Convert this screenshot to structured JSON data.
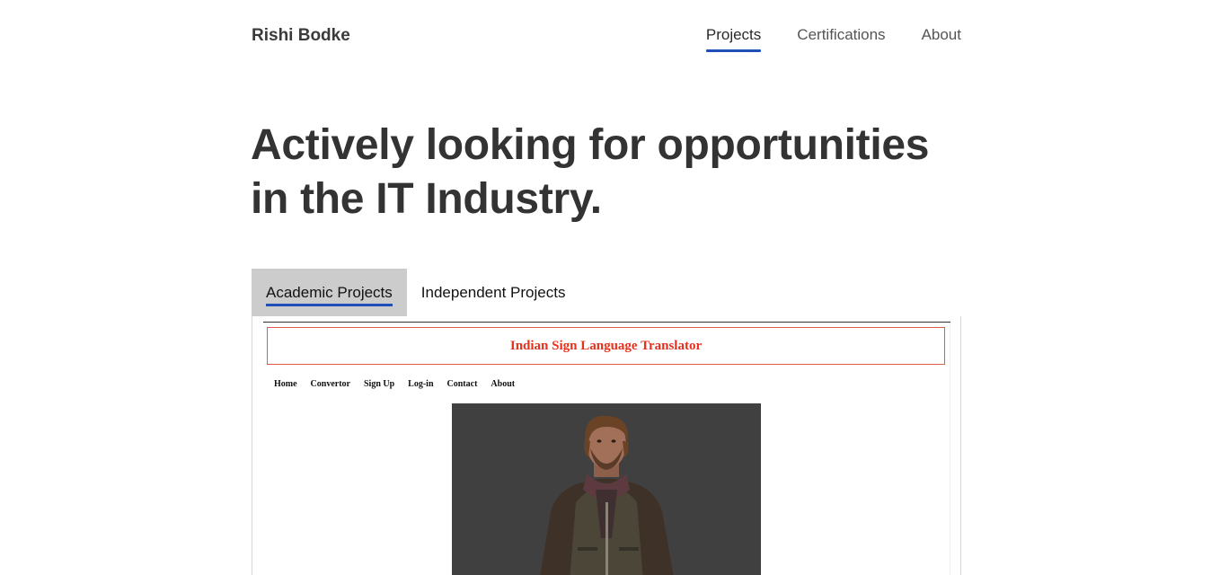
{
  "header": {
    "brand": "Rishi Bodke",
    "nav": [
      {
        "label": "Projects",
        "active": true
      },
      {
        "label": "Certifications",
        "active": false
      },
      {
        "label": "About",
        "active": false
      }
    ]
  },
  "hero": {
    "headline": "Actively looking for opportunities in the IT Industry."
  },
  "tabs": [
    {
      "label": "Academic Projects",
      "active": true
    },
    {
      "label": "Independent Projects",
      "active": false
    }
  ],
  "project_preview": {
    "title": "Indian Sign Language Translator",
    "nav": [
      "Home",
      "Convertor",
      "Sign Up",
      "Log-in",
      "Contact",
      "About"
    ]
  },
  "colors": {
    "accent": "#1f4fb7",
    "tab_active_bg": "#cccccc",
    "preview_title": "#e8301c",
    "avatar_bg": "#404040"
  }
}
